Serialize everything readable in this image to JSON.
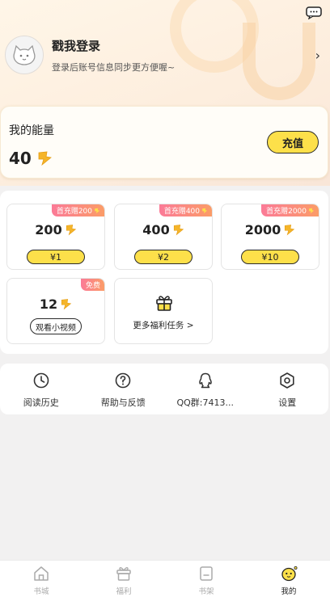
{
  "profile": {
    "login_title": "戳我登录",
    "login_subtitle": "登录后账号信息同步更方便喔~"
  },
  "energy": {
    "label": "我的能量",
    "value": "40",
    "recharge_label": "充值"
  },
  "packs": [
    {
      "badge": "首充赠200",
      "amount": "200",
      "price": "¥1"
    },
    {
      "badge": "首充赠400",
      "amount": "400",
      "price": "¥2"
    },
    {
      "badge": "首充赠2000",
      "amount": "2000",
      "price": "¥10"
    }
  ],
  "video_pack": {
    "badge": "免费",
    "amount": "12",
    "action": "观看小视频"
  },
  "more_tasks": {
    "label": "更多福利任务",
    "arrow": ">"
  },
  "tools": [
    {
      "label": "阅读历史",
      "icon": "clock-icon"
    },
    {
      "label": "帮助与反馈",
      "icon": "question-icon"
    },
    {
      "label": "QQ群:7413...",
      "icon": "qq-icon"
    },
    {
      "label": "设置",
      "icon": "gear-icon"
    }
  ],
  "tabs": [
    {
      "label": "书城",
      "icon": "home-icon",
      "active": false
    },
    {
      "label": "福利",
      "icon": "gift-icon",
      "active": false
    },
    {
      "label": "书架",
      "icon": "bookshelf-icon",
      "active": false
    },
    {
      "label": "我的",
      "icon": "mascot-icon",
      "active": true
    }
  ],
  "colors": {
    "accent_yellow": "#fde04a",
    "badge_gradient_start": "#fb7a97",
    "badge_gradient_end": "#fb9c67",
    "energy_icon": "#f5b52a"
  }
}
